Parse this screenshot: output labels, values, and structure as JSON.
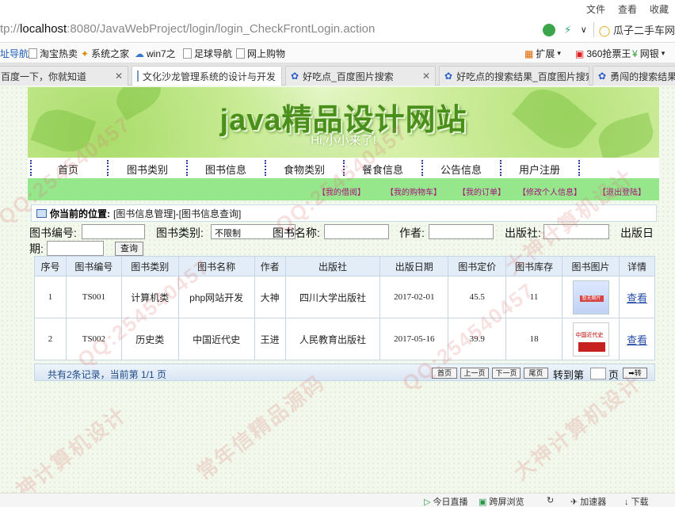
{
  "browser": {
    "menus": [
      "文件",
      "查看",
      "收藏"
    ],
    "url_host": "localhost",
    "url_rest": ":8080/JavaWebProject/login/login_CheckFrontLogin.action",
    "url_prefix": "tp://",
    "search_text": "瓜子二手车网",
    "bookmarks": [
      "址导航",
      "淘宝热卖",
      "系统之家",
      "win7之",
      "足球导航",
      "网上购物"
    ],
    "bookmarks_right": [
      "扩展",
      "360抢票王",
      "网银"
    ],
    "tabs": [
      {
        "label": "百度一下，你就知道"
      },
      {
        "label": "文化沙龙管理系统的设计与开发"
      },
      {
        "label": "好吃点_百度图片搜索"
      },
      {
        "label": "好吃点的搜索结果_百度图片搜索"
      },
      {
        "label": "勇闯的搜索结果_"
      }
    ],
    "status": [
      "今日直播",
      "跨屏浏览",
      "加速器",
      "下载"
    ]
  },
  "banner": {
    "title": "java精品设计网站",
    "subtitle": "Hi,小小来了!"
  },
  "nav": [
    "首页",
    "图书类别",
    "图书信息",
    "食物类别",
    "餐食信息",
    "公告信息",
    "用户注册"
  ],
  "user_links": [
    "【我的借阅】",
    "【我的购物车】",
    "【我的订单】",
    "【修改个人信息】",
    "【退出登陆】"
  ],
  "location": {
    "label": "你当前的位置:",
    "path": "[图书信息管理]-[图书信息查询]"
  },
  "filters": {
    "book_no": "图书编号:",
    "book_type": "图书类别:",
    "book_type_value": "不限制",
    "book_name": "图书名称:",
    "author": "作者:",
    "publisher": "出版社:",
    "pub_date_a": "出版日",
    "pub_date_b": "期:",
    "query_button": "查询"
  },
  "table": {
    "headers": [
      "序号",
      "图书编号",
      "图书类别",
      "图书名称",
      "作者",
      "出版社",
      "出版日期",
      "图书定价",
      "图书库存",
      "图书图片",
      "详情"
    ],
    "rows": [
      [
        "1",
        "TS001",
        "计算机类",
        "php网站开发",
        "大神",
        "四川大学出版社",
        "2017-02-01",
        "45.5",
        "11",
        "",
        "查看"
      ],
      [
        "2",
        "TS002",
        "历史类",
        "中国近代史",
        "王进",
        "人民教育出版社",
        "2017-05-16",
        "39.9",
        "18",
        "",
        "查看"
      ]
    ],
    "cover1_text": "暂无图片",
    "cover2_text": "中国近代史"
  },
  "pager": {
    "summary": "共有2条记录，当前第 1/1 页",
    "first": "首页",
    "prev": "上一页",
    "next": "下一页",
    "last": "尾页",
    "goto": "转到第",
    "page": "页",
    "go": "➡转"
  },
  "watermarks": [
    "QQ:254540457",
    "大神计算机设计",
    "常年信精品源码"
  ]
}
